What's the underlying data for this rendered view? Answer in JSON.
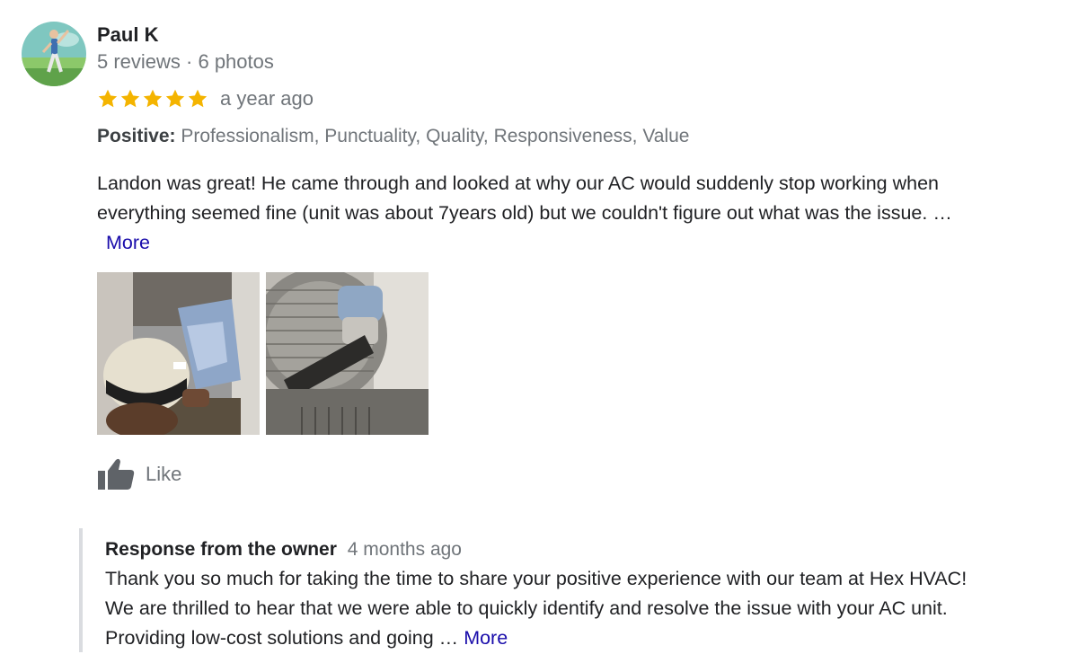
{
  "reviewer": {
    "name": "Paul K",
    "meta": "5 reviews · 6 photos"
  },
  "rating": {
    "stars": 5,
    "max_stars": 5,
    "time": "a year ago",
    "star_color": "#f4b400"
  },
  "highlights": {
    "label": "Positive:",
    "items": "Professionalism, Punctuality, Quality, Responsiveness, Value"
  },
  "review": {
    "line1": "Landon was great! He came through and looked at why our AC would suddenly stop working  when",
    "line2": "everything seemed fine (unit was about 7years old) but we couldn't figure out what was the issue. …",
    "more_label": "More"
  },
  "photos": [
    {
      "subject": "technician-at-furnace-photo"
    },
    {
      "subject": "ac-blower-fan-photo"
    }
  ],
  "like": {
    "label": "Like"
  },
  "owner_response": {
    "title": "Response from the owner",
    "time": "4 months ago",
    "line1": "Thank you so much for taking the time to share your positive experience with our team at Hex HVAC!",
    "line2": "We are thrilled to hear that we were able to quickly identify and resolve the issue with your AC unit.",
    "line3": "Providing low-cost solutions and going …",
    "more_label": "More"
  },
  "colors": {
    "link": "#1a0dab",
    "muted": "#70757a",
    "star": "#f4b400",
    "response_border": "#dadce0"
  }
}
